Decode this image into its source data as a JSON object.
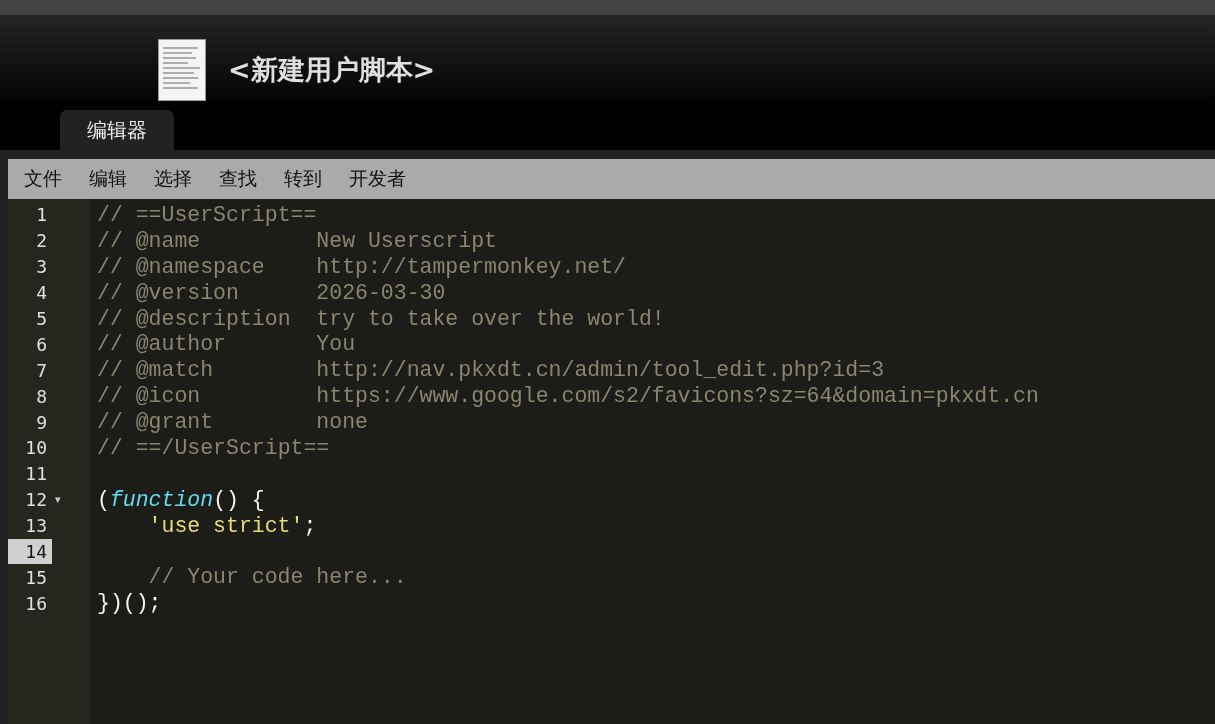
{
  "header": {
    "title": "<新建用户脚本>"
  },
  "tabs": [
    {
      "label": "编辑器",
      "selected": true
    }
  ],
  "menu": [
    "文件",
    "编辑",
    "选择",
    "查找",
    "转到",
    "开发者"
  ],
  "editor": {
    "lines": [
      {
        "number": "1",
        "active": false,
        "indented": false,
        "segments": [
          {
            "kind": "comment",
            "text": "// ==UserScript=="
          }
        ]
      },
      {
        "number": "2",
        "active": false,
        "indented": false,
        "segments": [
          {
            "kind": "comment",
            "text": "// @name         New Userscript"
          }
        ]
      },
      {
        "number": "3",
        "active": false,
        "indented": false,
        "segments": [
          {
            "kind": "comment",
            "text": "// @namespace    http://tampermonkey.net/"
          }
        ]
      },
      {
        "number": "4",
        "active": false,
        "indented": false,
        "segments": [
          {
            "kind": "comment",
            "text": "// @version      2026-03-30"
          }
        ]
      },
      {
        "number": "5",
        "active": false,
        "indented": false,
        "segments": [
          {
            "kind": "comment",
            "text": "// @description  try to take over the world!"
          }
        ]
      },
      {
        "number": "6",
        "active": false,
        "indented": false,
        "segments": [
          {
            "kind": "comment",
            "text": "// @author       You"
          }
        ]
      },
      {
        "number": "7",
        "active": false,
        "indented": false,
        "segments": [
          {
            "kind": "comment",
            "text": "// @match        http://nav.pkxdt.cn/admin/tool_edit.php?id=3"
          }
        ]
      },
      {
        "number": "8",
        "active": false,
        "indented": false,
        "segments": [
          {
            "kind": "comment",
            "text": "// @icon         https://www.google.com/s2/favicons?sz=64&domain=pkxdt.cn"
          }
        ]
      },
      {
        "number": "9",
        "active": false,
        "indented": false,
        "segments": [
          {
            "kind": "comment",
            "text": "// @grant        none"
          }
        ]
      },
      {
        "number": "10",
        "active": false,
        "indented": false,
        "segments": [
          {
            "kind": "comment",
            "text": "// ==/UserScript=="
          }
        ]
      },
      {
        "number": "11",
        "active": false
      },
      {
        "number": "12",
        "active": false,
        "indented": false,
        "fold": "▾",
        "segments": [
          {
            "kind": "plain",
            "text": "("
          },
          {
            "kind": "keyword",
            "text": "function"
          },
          {
            "kind": "plain",
            "text": "() {"
          }
        ]
      },
      {
        "number": "13",
        "active": false,
        "indented": true,
        "segments": [
          {
            "kind": "string",
            "text": "'use strict'"
          },
          {
            "kind": "plain",
            "text": ";"
          }
        ]
      },
      {
        "number": "14",
        "active": true
      },
      {
        "number": "15",
        "active": false,
        "indented": true,
        "segments": [
          {
            "kind": "comment",
            "text": "// Your code here..."
          }
        ]
      },
      {
        "number": "16",
        "active": false,
        "indented": false,
        "segments": [
          {
            "kind": "plain",
            "text": "})();"
          }
        ]
      }
    ]
  }
}
